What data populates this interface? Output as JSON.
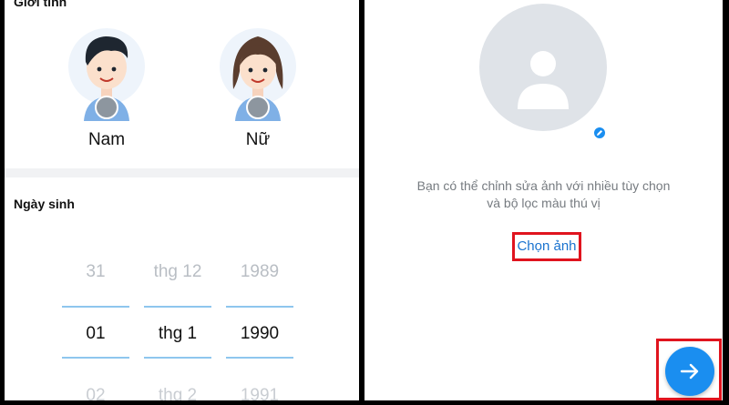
{
  "left": {
    "gender_title": "Giới tính",
    "gender_options": [
      {
        "label": "Nam",
        "icon": "male-avatar-icon"
      },
      {
        "label": "Nữ",
        "icon": "female-avatar-icon"
      }
    ],
    "birth_title": "Ngày sinh",
    "picker": {
      "day": {
        "prev": "31",
        "selected": "01",
        "next": "02"
      },
      "month": {
        "prev": "thg 12",
        "selected": "thg 1",
        "next": "thg 2"
      },
      "year": {
        "prev": "1989",
        "selected": "1990",
        "next": "1991"
      }
    }
  },
  "right": {
    "avatar_icon": "person-placeholder-icon",
    "edit_icon": "pencil-icon",
    "hint_line1": "Bạn có thể chỉnh sửa ảnh với nhiều tùy chọn",
    "hint_line2": "và bộ lọc màu thú vị",
    "choose_photo": "Chọn ảnh",
    "next_icon": "arrow-right-icon"
  },
  "colors": {
    "accent": "#1a8ef0",
    "link": "#1a73cf",
    "highlight": "#e0141e",
    "picker_line": "#8ec6ee",
    "placeholder_bg": "#dfe3e8"
  }
}
